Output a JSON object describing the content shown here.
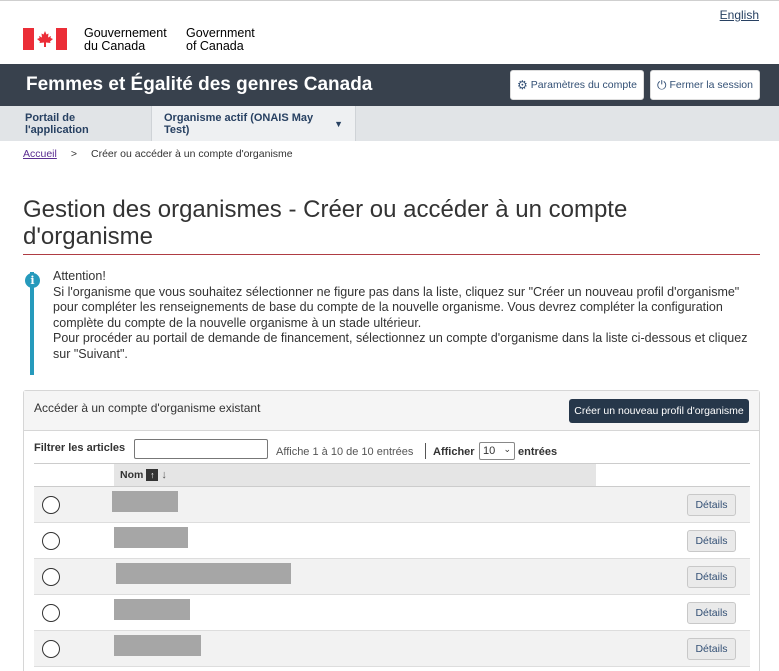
{
  "header": {
    "language_link": "English",
    "signature_fr_line1": "Gouvernement",
    "signature_fr_line2": "du Canada",
    "signature_en_line1": "Government",
    "signature_en_line2": "of Canada",
    "flag_icon": "canada-flag-icon",
    "brand_red": "#eb2d37"
  },
  "app_bar": {
    "title": "Femmes et Égalité des genres Canada",
    "settings_label": "Paramètres du compte",
    "settings_icon": "gear-icon",
    "logout_label": "Fermer la session",
    "logout_icon": "power-icon",
    "background": "#38414d"
  },
  "menu": {
    "portal_label": "Portail de l'application",
    "org_label": "Organisme actif (ONAIS May Test)",
    "org_icon": "chevron-down-icon"
  },
  "breadcrumb": {
    "home": "Accueil",
    "separator": ">",
    "current": "Créer ou accéder à un compte d'organisme"
  },
  "page": {
    "title": "Gestion des organismes - Créer ou accéder à un compte d'organisme"
  },
  "alert": {
    "icon": "info-icon",
    "heading": "Attention!",
    "line1": "Si l'organisme que vous souhaitez sélectionner ne figure pas dans la liste, cliquez sur \"Créer un nouveau profil d'organisme\" pour compléter les renseignements de base du compte de la nouvelle organisme. Vous devrez compléter la configuration complète du compte de la nouvelle organisme à un stade ultérieur.",
    "line2": "Pour procéder au portail de demande de financement, sélectionnez un compte d'organisme dans la liste ci-dessous et cliquez sur \"Suivant\"."
  },
  "panel": {
    "title": "Accéder à un compte d'organisme existant",
    "new_button": "Créer un nouveau profil d'organisme",
    "filter_label": "Filtrer les articles",
    "filter_value": "",
    "entries_info": "Affiche 1 à 10 de 10 entrées",
    "show_label": "Afficher",
    "page_size": "10",
    "entries_label": "entrées",
    "column_name": "Nom",
    "sort_up_icon": "arrow-up-icon",
    "sort_down_icon": "arrow-down-icon",
    "details_label": "Détails"
  }
}
